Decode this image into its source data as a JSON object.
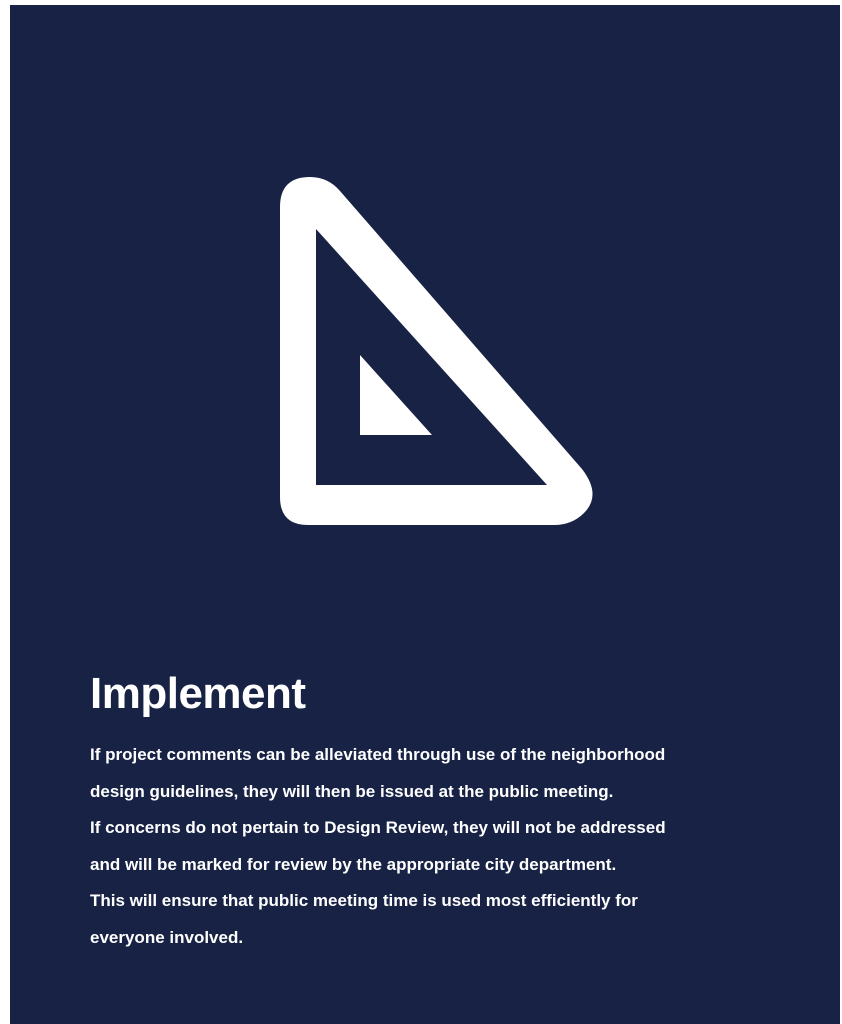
{
  "card": {
    "background_color": "#172244",
    "icon": "set-square-triangle-icon",
    "icon_color": "#ffffff"
  },
  "heading": "Implement",
  "paragraph_lines": [
    "If project comments can be alleviated through use of the neighborhood",
    "design guidelines, they will then be issued at the public meeting.",
    "If concerns do not pertain to Design Review, they will not be addressed",
    "and will be marked for review by the appropriate city department.",
    "This will ensure that public meeting time is used most efficiently for",
    "everyone involved."
  ]
}
